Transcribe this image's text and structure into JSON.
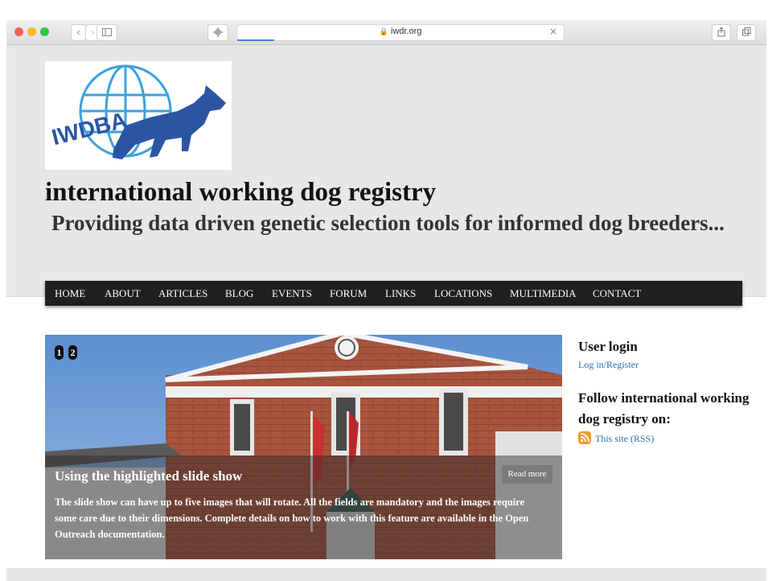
{
  "browser": {
    "url": "iwdr.org",
    "back_icon": "chevron-left-icon",
    "forward_icon": "chevron-right-icon",
    "sidebar_icon": "sidebar-icon",
    "extension_icon": "puzzle-icon",
    "clear_icon": "close-icon",
    "share_icon": "share-icon",
    "tabs_icon": "tabs-icon"
  },
  "header": {
    "logo_text": "IWDBA",
    "site_name": "international working dog registry",
    "slogan": "Providing data driven genetic selection tools for informed dog breeders..."
  },
  "menu": {
    "items": [
      "HOME",
      "ABOUT",
      "ARTICLES",
      "BLOG",
      "EVENTS",
      "FORUM",
      "LINKS",
      "LOCATIONS",
      "MULTIMEDIA",
      "CONTACT"
    ]
  },
  "slideshow": {
    "pager": [
      "1",
      "2"
    ],
    "title": "Using the highlighted slide show",
    "body": "The slide show can have up to five images that will rotate. All the fields are mandatory and the images require some care due to their dimensions. Complete details on how to work with this feature are available in the Open Outreach documentation.",
    "read_more": "Read more"
  },
  "sidebar": {
    "login_heading": "User login",
    "login_link": "Log in/Register",
    "follow_heading": "Follow international working dog registry on:",
    "rss_link": "This site (RSS)"
  },
  "colors": {
    "menu_bg": "#1f1f1f",
    "header_bg": "#e7e7e7",
    "link": "#2a6fb0",
    "logo_blue": "#2b55a3",
    "logo_globe": "#3ea0dc"
  }
}
